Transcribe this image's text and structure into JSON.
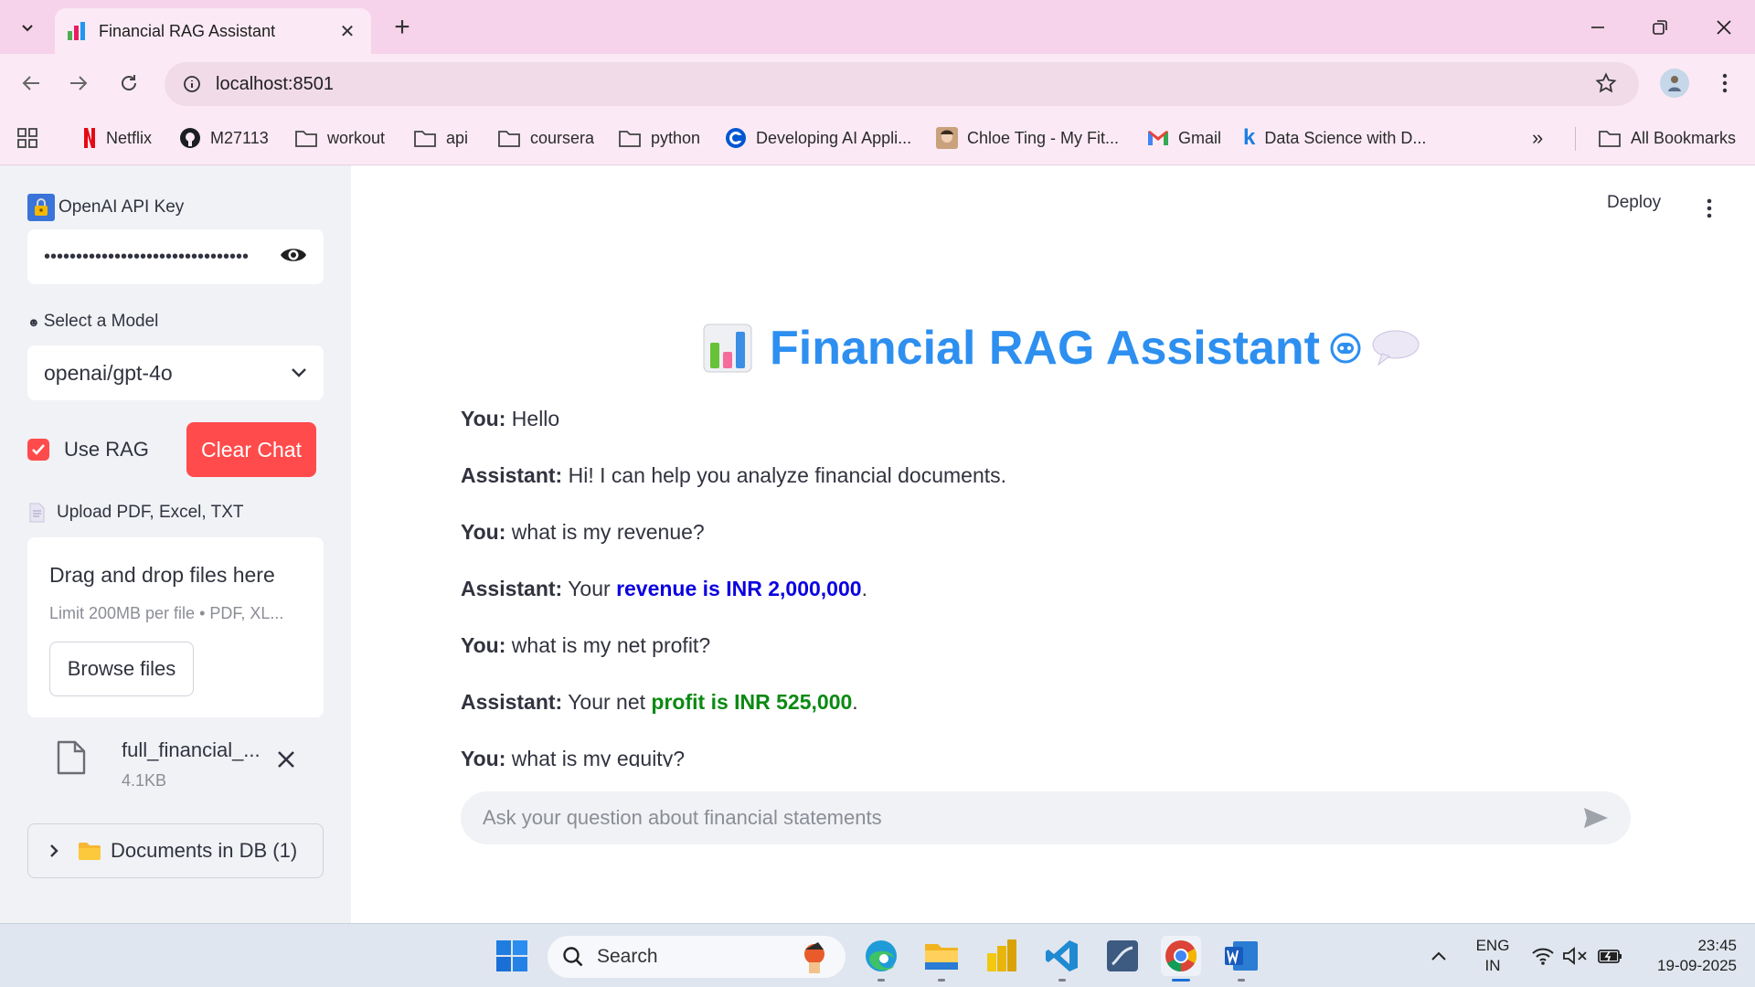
{
  "browser": {
    "tab_title": "Financial RAG Assistant",
    "url": "localhost:8501",
    "bookmarks": [
      {
        "label": "Netflix",
        "icon": "netflix-icon"
      },
      {
        "label": "M27113",
        "icon": "github-icon"
      },
      {
        "label": "workout",
        "icon": "folder-icon"
      },
      {
        "label": "api",
        "icon": "folder-icon"
      },
      {
        "label": "coursera",
        "icon": "folder-icon"
      },
      {
        "label": "python",
        "icon": "folder-icon"
      },
      {
        "label": "Developing AI Appli...",
        "icon": "coursera-icon"
      },
      {
        "label": "Chloe Ting - My Fit...",
        "icon": "avatar-icon"
      },
      {
        "label": "Gmail",
        "icon": "gmail-icon"
      },
      {
        "label": "Data Science with D...",
        "icon": "k-icon"
      }
    ],
    "all_bookmarks": "All Bookmarks"
  },
  "sidebar": {
    "api_key_label": "OpenAI API Key",
    "api_key_value": "••••••••••••••••••••••••••••••••",
    "model_label": "Select a Model",
    "model_value": "openai/gpt-4o",
    "use_rag_label": "Use RAG",
    "use_rag_checked": true,
    "clear_chat_label": "Clear Chat",
    "upload_label": "Upload PDF, Excel, TXT",
    "uploader": {
      "title": "Drag and drop files here",
      "limit": "Limit 200MB per file • PDF, XL...",
      "browse_label": "Browse files"
    },
    "file": {
      "name": "full_financial_...",
      "size": "4.1KB"
    },
    "documents_expander": "Documents in DB (1)"
  },
  "main": {
    "deploy_label": "Deploy",
    "title": "Financial RAG Assistant",
    "messages": [
      {
        "role": "You:",
        "text": "Hello"
      },
      {
        "role": "Assistant:",
        "text": "Hi! I can help you analyze financial documents."
      },
      {
        "role": "You:",
        "text": "what is my revenue?"
      },
      {
        "role": "Assistant:",
        "pre": "Your ",
        "highlight": "revenue is INR 2,000,000",
        "post": ".",
        "color": "#0a00e0"
      },
      {
        "role": "You:",
        "text": "what is my net profit?"
      },
      {
        "role": "Assistant:",
        "pre": "Your net ",
        "highlight": "profit is INR 525,000",
        "post": ".",
        "color": "#0b8a12"
      },
      {
        "role": "You:",
        "text": "what is my equity?"
      }
    ],
    "chat_placeholder": "Ask your question about financial statements"
  },
  "taskbar": {
    "search_label": "Search",
    "lang_line1": "ENG",
    "lang_line2": "IN",
    "time": "23:45",
    "date": "19-09-2025"
  },
  "colors": {
    "accent_red": "#ff4b4b",
    "title_blue": "#2d8ff0",
    "chrome_pink": "#f6d3ea"
  }
}
